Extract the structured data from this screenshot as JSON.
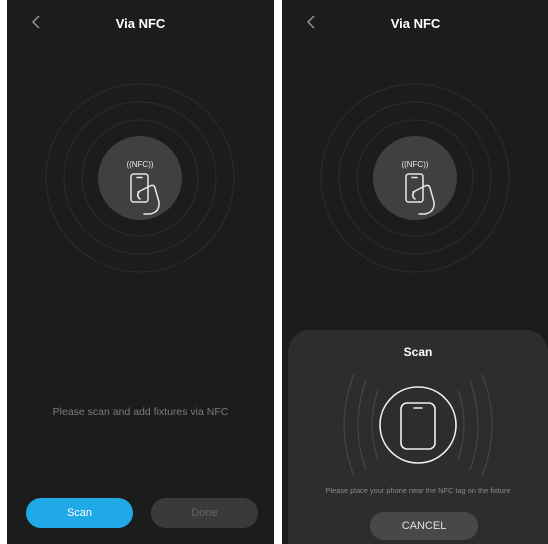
{
  "left_screen": {
    "header": {
      "back_icon": "chevron-left-icon",
      "title": "Via NFC"
    },
    "nfc_badge": "((NFC))",
    "hint": "Please scan and add fixtures via NFC",
    "buttons": {
      "scan": "Scan",
      "done": "Done"
    }
  },
  "right_screen": {
    "header": {
      "back_icon": "chevron-left-icon",
      "title": "Via NFC"
    },
    "nfc_badge": "((NFC))",
    "scan_sheet": {
      "title": "Scan",
      "icon": "phone-outline-icon",
      "hint": "Please place your phone near the NFC tag on the fixture",
      "cancel": "CANCEL"
    }
  },
  "colors": {
    "background": "#1c1c1c",
    "accent": "#1fa9e6",
    "sheet": "#2d2d2d",
    "muted_text": "#7c7c7c"
  }
}
